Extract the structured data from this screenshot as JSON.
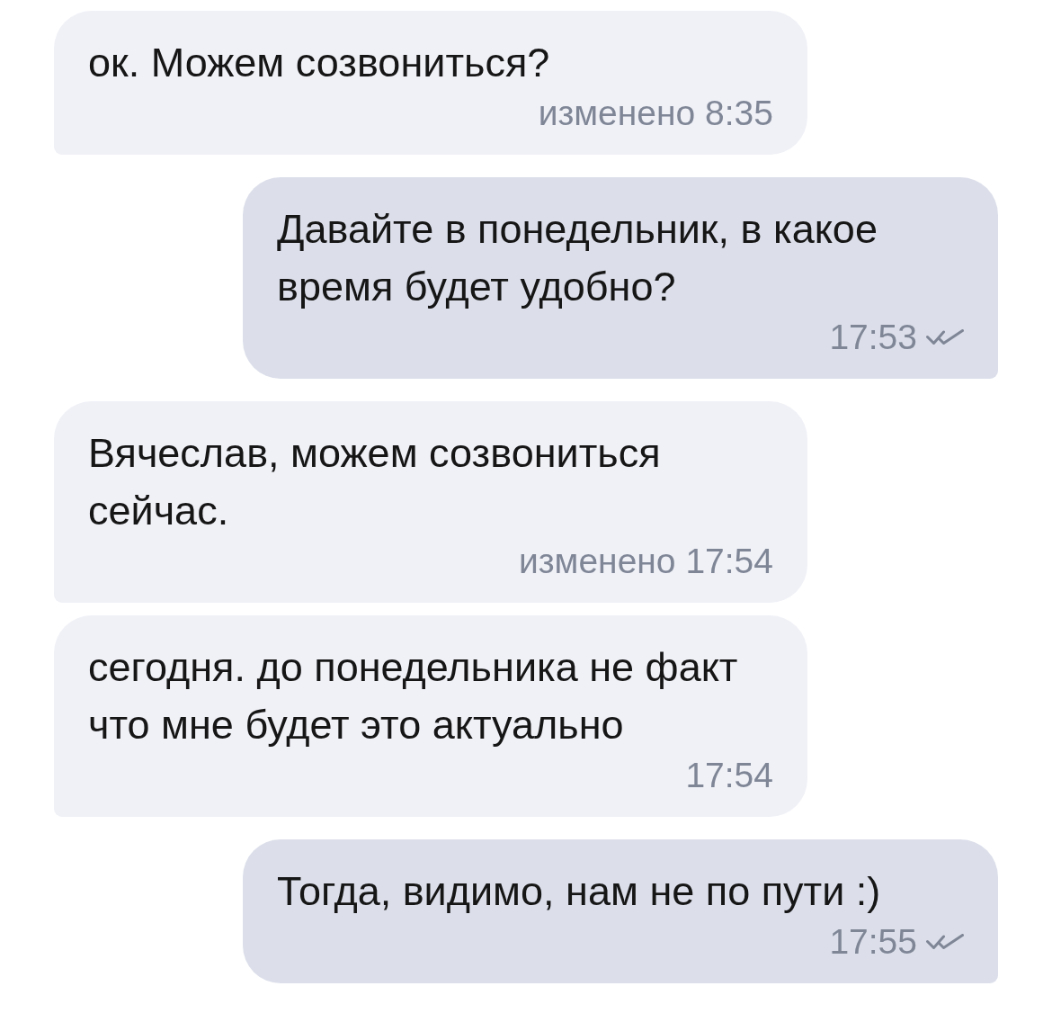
{
  "messages": [
    {
      "kind": "incoming",
      "text": "ок. Можем созвониться?",
      "time": "изменено 8:35"
    },
    {
      "kind": "outgoing",
      "text": "Давайте в понедельник, в какое время будет удобно?",
      "time": "17:53",
      "read": true
    },
    {
      "kind": "incoming",
      "text": "Вячеслав, можем созвониться сейчас.",
      "time": "изменено 17:54"
    },
    {
      "kind": "incoming",
      "text": "сегодня. до понедельника не факт что мне будет это актуально",
      "time": "17:54"
    },
    {
      "kind": "outgoing",
      "text": "Тогда, видимо, нам не по пути :)",
      "time": "17:55",
      "read": true
    }
  ]
}
